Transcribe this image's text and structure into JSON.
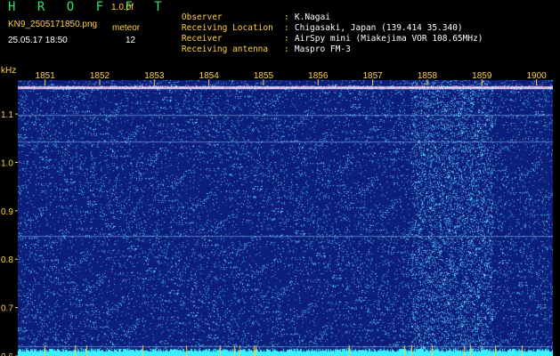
{
  "header": {
    "title": "H R O F F T",
    "version": "1.0.0f",
    "file_name": "KN9_2505171850.png",
    "timestamp": "25.05.17 18:50",
    "meteor_label": "meteor",
    "meteor_count": "12"
  },
  "info": [
    {
      "key": "Observer",
      "sep": ":",
      "value": "K.Nagai"
    },
    {
      "key": "Receiving Location",
      "sep": ":",
      "value": "Chigasaki, Japan (139.414 35.340)"
    },
    {
      "key": "Receiver",
      "sep": ":",
      "value": "AirSpy mini (Miakejima VOR 108.65MHz)"
    },
    {
      "key": "Receiving antenna",
      "sep": ":",
      "value": "Maspro FM-3"
    }
  ],
  "colors": {
    "title": "#2ee06a",
    "label": "#ffd23c",
    "value": "#ffffff",
    "axis": "#ffd23c",
    "waterfall_bg": "#0a1a6e",
    "power_trace": "#3cf0ff"
  },
  "chart_data": {
    "type": "heatmap",
    "ylabel": "kHz",
    "ylim": [
      0.6,
      1.17
    ],
    "yticks": [
      "1.1",
      "1.0",
      "0.9",
      "0.8",
      "0.7",
      "0.6"
    ],
    "yvalues": [
      1.1,
      1.0,
      0.9,
      0.8,
      0.7,
      0.6
    ],
    "xlim": [
      1850.5,
      1900.3
    ],
    "xticks": [
      "1851",
      "1852",
      "1853",
      "1854",
      "1855",
      "1856",
      "1857",
      "1858",
      "1859",
      "1900"
    ],
    "xvalues": [
      1851,
      1852,
      1853,
      1854,
      1855,
      1856,
      1857,
      1858,
      1859,
      1900
    ],
    "x_is_time_hhmm": true,
    "features": {
      "carrier_khz": 1.155,
      "horizontal_lines_khz": [
        1.098,
        1.043,
        0.848,
        0.62,
        0.605
      ],
      "meteor_band_minutes": [
        1857.7,
        1859.2
      ]
    }
  }
}
